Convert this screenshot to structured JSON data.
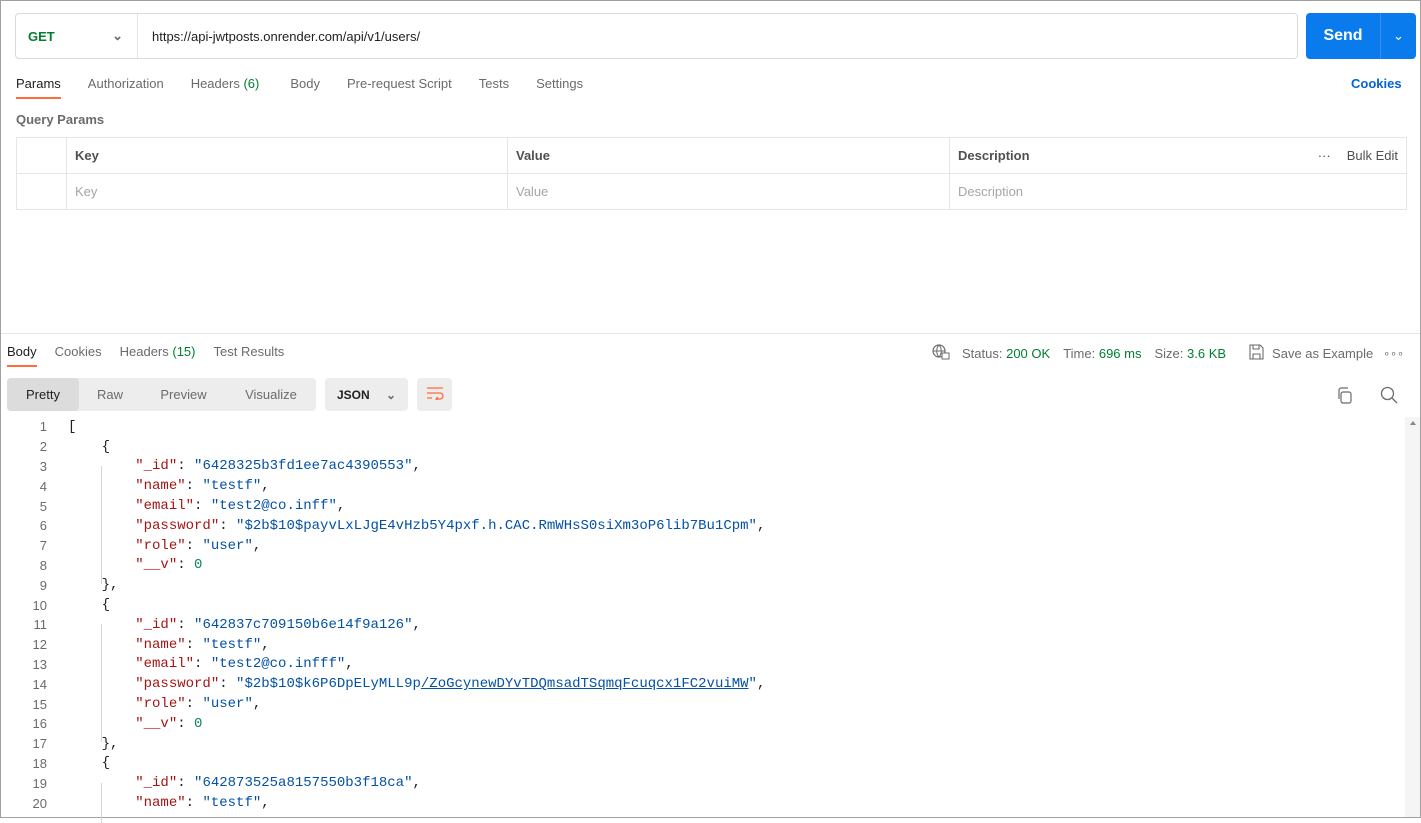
{
  "request": {
    "method": "GET",
    "url": "https://api-jwtposts.onrender.com/api/v1/users/",
    "send_label": "Send"
  },
  "request_tabs": [
    {
      "label": "Params"
    },
    {
      "label": "Authorization"
    },
    {
      "label": "Headers",
      "count": "(6)"
    },
    {
      "label": "Body"
    },
    {
      "label": "Pre-request Script"
    },
    {
      "label": "Tests"
    },
    {
      "label": "Settings"
    }
  ],
  "cookies_label": "Cookies",
  "query_params": {
    "title": "Query Params",
    "headers": [
      "Key",
      "Value",
      "Description"
    ],
    "bulk_edit": "Bulk Edit",
    "placeholders": [
      "Key",
      "Value",
      "Description"
    ]
  },
  "response_tabs": [
    {
      "label": "Body"
    },
    {
      "label": "Cookies"
    },
    {
      "label": "Headers",
      "count": "(15)"
    },
    {
      "label": "Test Results"
    }
  ],
  "status": {
    "status_label": "Status:",
    "status_value": "200 OK",
    "time_label": "Time:",
    "time_value": "696 ms",
    "size_label": "Size:",
    "size_value": "3.6 KB",
    "save_example": "Save as Example"
  },
  "view_modes": [
    "Pretty",
    "Raw",
    "Preview",
    "Visualize"
  ],
  "format": "JSON",
  "accent": "#ff6c37",
  "send_color": "#097bed",
  "code_lines": [
    [
      [
        "p",
        "["
      ]
    ],
    [
      [
        "p",
        "    {"
      ]
    ],
    [
      [
        "p",
        "        "
      ],
      [
        "k",
        "\"_id\""
      ],
      [
        "p",
        ": "
      ],
      [
        "s",
        "\"6428325b3fd1ee7ac4390553\""
      ],
      [
        "p",
        ","
      ]
    ],
    [
      [
        "p",
        "        "
      ],
      [
        "k",
        "\"name\""
      ],
      [
        "p",
        ": "
      ],
      [
        "s",
        "\"testf\""
      ],
      [
        "p",
        ","
      ]
    ],
    [
      [
        "p",
        "        "
      ],
      [
        "k",
        "\"email\""
      ],
      [
        "p",
        ": "
      ],
      [
        "s",
        "\"test2@co.inff\""
      ],
      [
        "p",
        ","
      ]
    ],
    [
      [
        "p",
        "        "
      ],
      [
        "k",
        "\"password\""
      ],
      [
        "p",
        ": "
      ],
      [
        "s",
        "\"$2b$10$payvLxLJgE4vHzb5Y4pxf.h.CAC.RmWHsS0siXm3oP6lib7Bu1Cpm\""
      ],
      [
        "p",
        ","
      ]
    ],
    [
      [
        "p",
        "        "
      ],
      [
        "k",
        "\"role\""
      ],
      [
        "p",
        ": "
      ],
      [
        "s",
        "\"user\""
      ],
      [
        "p",
        ","
      ]
    ],
    [
      [
        "p",
        "        "
      ],
      [
        "k",
        "\"__v\""
      ],
      [
        "p",
        ": "
      ],
      [
        "n",
        "0"
      ]
    ],
    [
      [
        "p",
        "    },"
      ]
    ],
    [
      [
        "p",
        "    {"
      ]
    ],
    [
      [
        "p",
        "        "
      ],
      [
        "k",
        "\"_id\""
      ],
      [
        "p",
        ": "
      ],
      [
        "s",
        "\"642837c709150b6e14f9a126\""
      ],
      [
        "p",
        ","
      ]
    ],
    [
      [
        "p",
        "        "
      ],
      [
        "k",
        "\"name\""
      ],
      [
        "p",
        ": "
      ],
      [
        "s",
        "\"testf\""
      ],
      [
        "p",
        ","
      ]
    ],
    [
      [
        "p",
        "        "
      ],
      [
        "k",
        "\"email\""
      ],
      [
        "p",
        ": "
      ],
      [
        "s",
        "\"test2@co.infff\""
      ],
      [
        "p",
        ","
      ]
    ],
    [
      [
        "p",
        "        "
      ],
      [
        "k",
        "\"password\""
      ],
      [
        "p",
        ": "
      ],
      [
        "s",
        "\"$2b$10$k6P6DpELyMLL9p"
      ],
      [
        "s link",
        "/ZoGcynewDYvTDQmsadTSqmqFcuqcx1FC2vuiMW"
      ],
      [
        "s",
        "\""
      ],
      [
        "p",
        ","
      ]
    ],
    [
      [
        "p",
        "        "
      ],
      [
        "k",
        "\"role\""
      ],
      [
        "p",
        ": "
      ],
      [
        "s",
        "\"user\""
      ],
      [
        "p",
        ","
      ]
    ],
    [
      [
        "p",
        "        "
      ],
      [
        "k",
        "\"__v\""
      ],
      [
        "p",
        ": "
      ],
      [
        "n",
        "0"
      ]
    ],
    [
      [
        "p",
        "    },"
      ]
    ],
    [
      [
        "p",
        "    {"
      ]
    ],
    [
      [
        "p",
        "        "
      ],
      [
        "k",
        "\"_id\""
      ],
      [
        "p",
        ": "
      ],
      [
        "s",
        "\"642873525a8157550b3f18ca\""
      ],
      [
        "p",
        ","
      ]
    ],
    [
      [
        "p",
        "        "
      ],
      [
        "k",
        "\"name\""
      ],
      [
        "p",
        ": "
      ],
      [
        "s",
        "\"testf\""
      ],
      [
        "p",
        ","
      ]
    ]
  ]
}
